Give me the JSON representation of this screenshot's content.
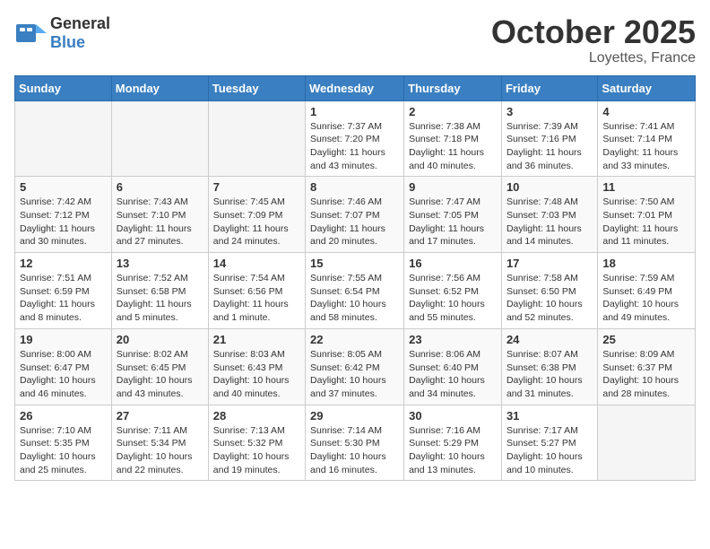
{
  "header": {
    "logo": {
      "text_general": "General",
      "text_blue": "Blue"
    },
    "month": "October 2025",
    "location": "Loyettes, France"
  },
  "weekdays": [
    "Sunday",
    "Monday",
    "Tuesday",
    "Wednesday",
    "Thursday",
    "Friday",
    "Saturday"
  ],
  "weeks": [
    [
      {
        "day": "",
        "info": ""
      },
      {
        "day": "",
        "info": ""
      },
      {
        "day": "",
        "info": ""
      },
      {
        "day": "1",
        "info": "Sunrise: 7:37 AM\nSunset: 7:20 PM\nDaylight: 11 hours and 43 minutes."
      },
      {
        "day": "2",
        "info": "Sunrise: 7:38 AM\nSunset: 7:18 PM\nDaylight: 11 hours and 40 minutes."
      },
      {
        "day": "3",
        "info": "Sunrise: 7:39 AM\nSunset: 7:16 PM\nDaylight: 11 hours and 36 minutes."
      },
      {
        "day": "4",
        "info": "Sunrise: 7:41 AM\nSunset: 7:14 PM\nDaylight: 11 hours and 33 minutes."
      }
    ],
    [
      {
        "day": "5",
        "info": "Sunrise: 7:42 AM\nSunset: 7:12 PM\nDaylight: 11 hours and 30 minutes."
      },
      {
        "day": "6",
        "info": "Sunrise: 7:43 AM\nSunset: 7:10 PM\nDaylight: 11 hours and 27 minutes."
      },
      {
        "day": "7",
        "info": "Sunrise: 7:45 AM\nSunset: 7:09 PM\nDaylight: 11 hours and 24 minutes."
      },
      {
        "day": "8",
        "info": "Sunrise: 7:46 AM\nSunset: 7:07 PM\nDaylight: 11 hours and 20 minutes."
      },
      {
        "day": "9",
        "info": "Sunrise: 7:47 AM\nSunset: 7:05 PM\nDaylight: 11 hours and 17 minutes."
      },
      {
        "day": "10",
        "info": "Sunrise: 7:48 AM\nSunset: 7:03 PM\nDaylight: 11 hours and 14 minutes."
      },
      {
        "day": "11",
        "info": "Sunrise: 7:50 AM\nSunset: 7:01 PM\nDaylight: 11 hours and 11 minutes."
      }
    ],
    [
      {
        "day": "12",
        "info": "Sunrise: 7:51 AM\nSunset: 6:59 PM\nDaylight: 11 hours and 8 minutes."
      },
      {
        "day": "13",
        "info": "Sunrise: 7:52 AM\nSunset: 6:58 PM\nDaylight: 11 hours and 5 minutes."
      },
      {
        "day": "14",
        "info": "Sunrise: 7:54 AM\nSunset: 6:56 PM\nDaylight: 11 hours and 1 minute."
      },
      {
        "day": "15",
        "info": "Sunrise: 7:55 AM\nSunset: 6:54 PM\nDaylight: 10 hours and 58 minutes."
      },
      {
        "day": "16",
        "info": "Sunrise: 7:56 AM\nSunset: 6:52 PM\nDaylight: 10 hours and 55 minutes."
      },
      {
        "day": "17",
        "info": "Sunrise: 7:58 AM\nSunset: 6:50 PM\nDaylight: 10 hours and 52 minutes."
      },
      {
        "day": "18",
        "info": "Sunrise: 7:59 AM\nSunset: 6:49 PM\nDaylight: 10 hours and 49 minutes."
      }
    ],
    [
      {
        "day": "19",
        "info": "Sunrise: 8:00 AM\nSunset: 6:47 PM\nDaylight: 10 hours and 46 minutes."
      },
      {
        "day": "20",
        "info": "Sunrise: 8:02 AM\nSunset: 6:45 PM\nDaylight: 10 hours and 43 minutes."
      },
      {
        "day": "21",
        "info": "Sunrise: 8:03 AM\nSunset: 6:43 PM\nDaylight: 10 hours and 40 minutes."
      },
      {
        "day": "22",
        "info": "Sunrise: 8:05 AM\nSunset: 6:42 PM\nDaylight: 10 hours and 37 minutes."
      },
      {
        "day": "23",
        "info": "Sunrise: 8:06 AM\nSunset: 6:40 PM\nDaylight: 10 hours and 34 minutes."
      },
      {
        "day": "24",
        "info": "Sunrise: 8:07 AM\nSunset: 6:38 PM\nDaylight: 10 hours and 31 minutes."
      },
      {
        "day": "25",
        "info": "Sunrise: 8:09 AM\nSunset: 6:37 PM\nDaylight: 10 hours and 28 minutes."
      }
    ],
    [
      {
        "day": "26",
        "info": "Sunrise: 7:10 AM\nSunset: 5:35 PM\nDaylight: 10 hours and 25 minutes."
      },
      {
        "day": "27",
        "info": "Sunrise: 7:11 AM\nSunset: 5:34 PM\nDaylight: 10 hours and 22 minutes."
      },
      {
        "day": "28",
        "info": "Sunrise: 7:13 AM\nSunset: 5:32 PM\nDaylight: 10 hours and 19 minutes."
      },
      {
        "day": "29",
        "info": "Sunrise: 7:14 AM\nSunset: 5:30 PM\nDaylight: 10 hours and 16 minutes."
      },
      {
        "day": "30",
        "info": "Sunrise: 7:16 AM\nSunset: 5:29 PM\nDaylight: 10 hours and 13 minutes."
      },
      {
        "day": "31",
        "info": "Sunrise: 7:17 AM\nSunset: 5:27 PM\nDaylight: 10 hours and 10 minutes."
      },
      {
        "day": "",
        "info": ""
      }
    ]
  ]
}
